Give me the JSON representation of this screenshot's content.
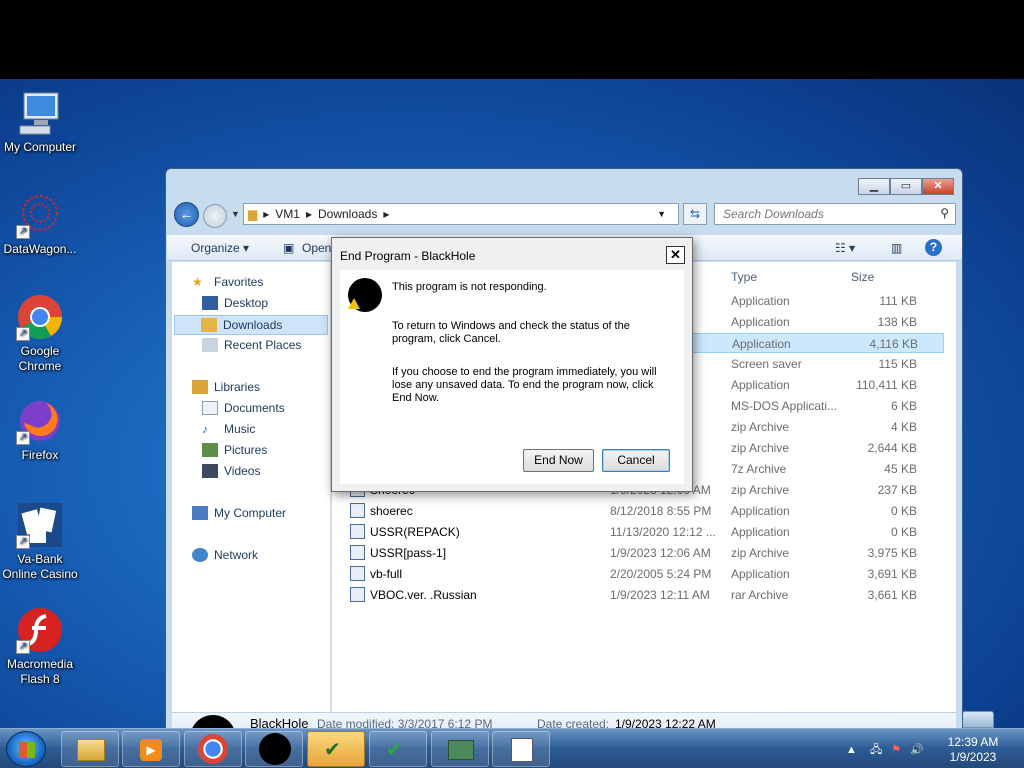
{
  "desktop": {
    "icons": [
      {
        "label": "My Computer"
      },
      {
        "label": "DataWagon..."
      },
      {
        "label": "Google Chrome"
      },
      {
        "label": "Firefox"
      },
      {
        "label": "Va-Bank Online Casino"
      },
      {
        "label": "Macromedia Flash 8"
      }
    ]
  },
  "explorer": {
    "breadcrumb": [
      "VM1",
      "Downloads"
    ],
    "search_placeholder": "Search Downloads",
    "toolbar": {
      "organize": "Organize ▾",
      "open": "Open"
    },
    "sidebar": {
      "favorites": "Favorites",
      "desktop": "Desktop",
      "downloads": "Downloads",
      "recent_places": "Recent Places",
      "libraries": "Libraries",
      "documents": "Documents",
      "music": "Music",
      "pictures": "Pictures",
      "videos": "Videos",
      "my_computer": "My Computer",
      "network": "Network"
    },
    "columns": {
      "type": "Type",
      "size": "Size"
    },
    "files": [
      {
        "name": "",
        "date": "PM",
        "type": "Application",
        "size": "111 KB"
      },
      {
        "name": "",
        "date": "AM",
        "type": "Application",
        "size": "138 KB"
      },
      {
        "name": "",
        "date": "M",
        "type": "Application",
        "size": "4,116 KB"
      },
      {
        "name": "",
        "date": "PM",
        "type": "Screen saver",
        "size": "115 KB"
      },
      {
        "name": "",
        "date": "AM",
        "type": "Application",
        "size": "110,411 KB"
      },
      {
        "name": "",
        "date": "PM",
        "type": "MS-DOS Applicati...",
        "size": "6 KB"
      },
      {
        "name": "",
        "date": "AM",
        "type": "zip Archive",
        "size": "4 KB"
      },
      {
        "name": "",
        "date": "AM",
        "type": "zip Archive",
        "size": "2,644 KB"
      },
      {
        "name": "",
        "date": "AM",
        "type": "7z Archive",
        "size": "45 KB"
      },
      {
        "name": "Shoerec",
        "date": "1/9/2023 12:00 AM",
        "type": "zip Archive",
        "size": "237 KB"
      },
      {
        "name": "shoerec",
        "date": "8/12/2018 8:55 PM",
        "type": "Application",
        "size": "0 KB"
      },
      {
        "name": "USSR(REPACK)",
        "date": "11/13/2020 12:12 ...",
        "type": "Application",
        "size": "0 KB"
      },
      {
        "name": "USSR[pass-1]",
        "date": "1/9/2023 12:06 AM",
        "type": "zip Archive",
        "size": "3,975 KB"
      },
      {
        "name": "vb-full",
        "date": "2/20/2005 5:24 PM",
        "type": "Application",
        "size": "3,691 KB"
      },
      {
        "name": "VBOC.ver. .Russian",
        "date": "1/9/2023 12:11 AM",
        "type": "rar Archive",
        "size": "3,661 KB"
      }
    ],
    "details": {
      "name": "BlackHole",
      "modified": "Date modified: 3/3/2017 6:12 PM",
      "created_label": "Date created:",
      "created": "1/9/2023 12:22 AM"
    }
  },
  "dialog": {
    "title": "End Program - BlackHole",
    "line1": "This program is not responding.",
    "line2": "To return to Windows and check the status of the program, click Cancel.",
    "line3": "If you choose to end the program immediately, you will lose any unsaved data. To end the program now, click End Now.",
    "end_now": "End Now",
    "cancel": "Cancel"
  },
  "taskbar": {
    "time": "12:39 AM",
    "date": "1/9/2023"
  }
}
